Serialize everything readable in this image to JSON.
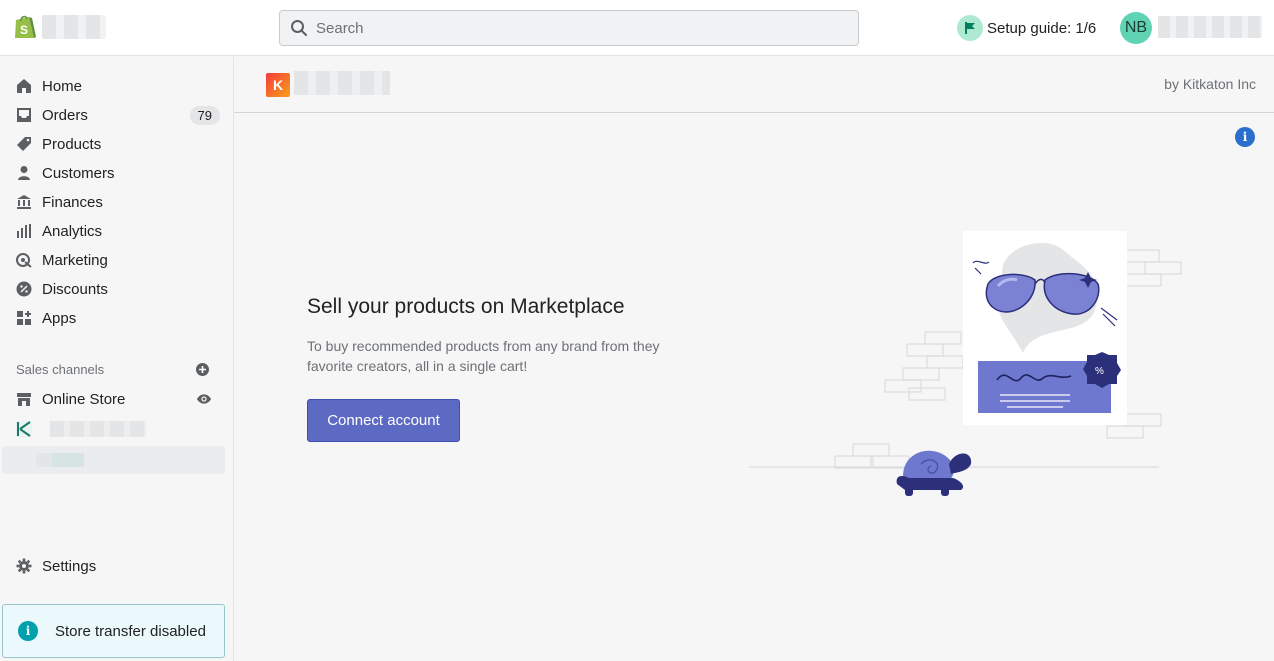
{
  "topbar": {
    "search_placeholder": "Search",
    "setup_guide": "Setup guide: 1/6",
    "avatar_initials": "NB"
  },
  "sidebar": {
    "items": [
      {
        "label": "Home",
        "icon": "home-icon"
      },
      {
        "label": "Orders",
        "icon": "inbox-icon",
        "badge": "79"
      },
      {
        "label": "Products",
        "icon": "tag-icon"
      },
      {
        "label": "Customers",
        "icon": "person-icon"
      },
      {
        "label": "Finances",
        "icon": "bank-icon"
      },
      {
        "label": "Analytics",
        "icon": "bar-chart-icon"
      },
      {
        "label": "Marketing",
        "icon": "target-icon"
      },
      {
        "label": "Discounts",
        "icon": "discount-icon"
      },
      {
        "label": "Apps",
        "icon": "apps-icon"
      }
    ],
    "sales_channels_title": "Sales channels",
    "online_store": "Online Store",
    "settings": "Settings",
    "store_transfer": "Store transfer disabled"
  },
  "app": {
    "logo_letter": "K",
    "by_line": "by Kitkaton Inc",
    "info_glyph": "i"
  },
  "hero": {
    "title": "Sell your products on Marketplace",
    "description": "To buy recommended products from any brand from they favorite creators, all in a single cart!",
    "cta": "Connect account"
  },
  "colors": {
    "primary": "#5c6ac4",
    "info_blue": "#2c6ecb",
    "teal": "#00a0ac"
  }
}
